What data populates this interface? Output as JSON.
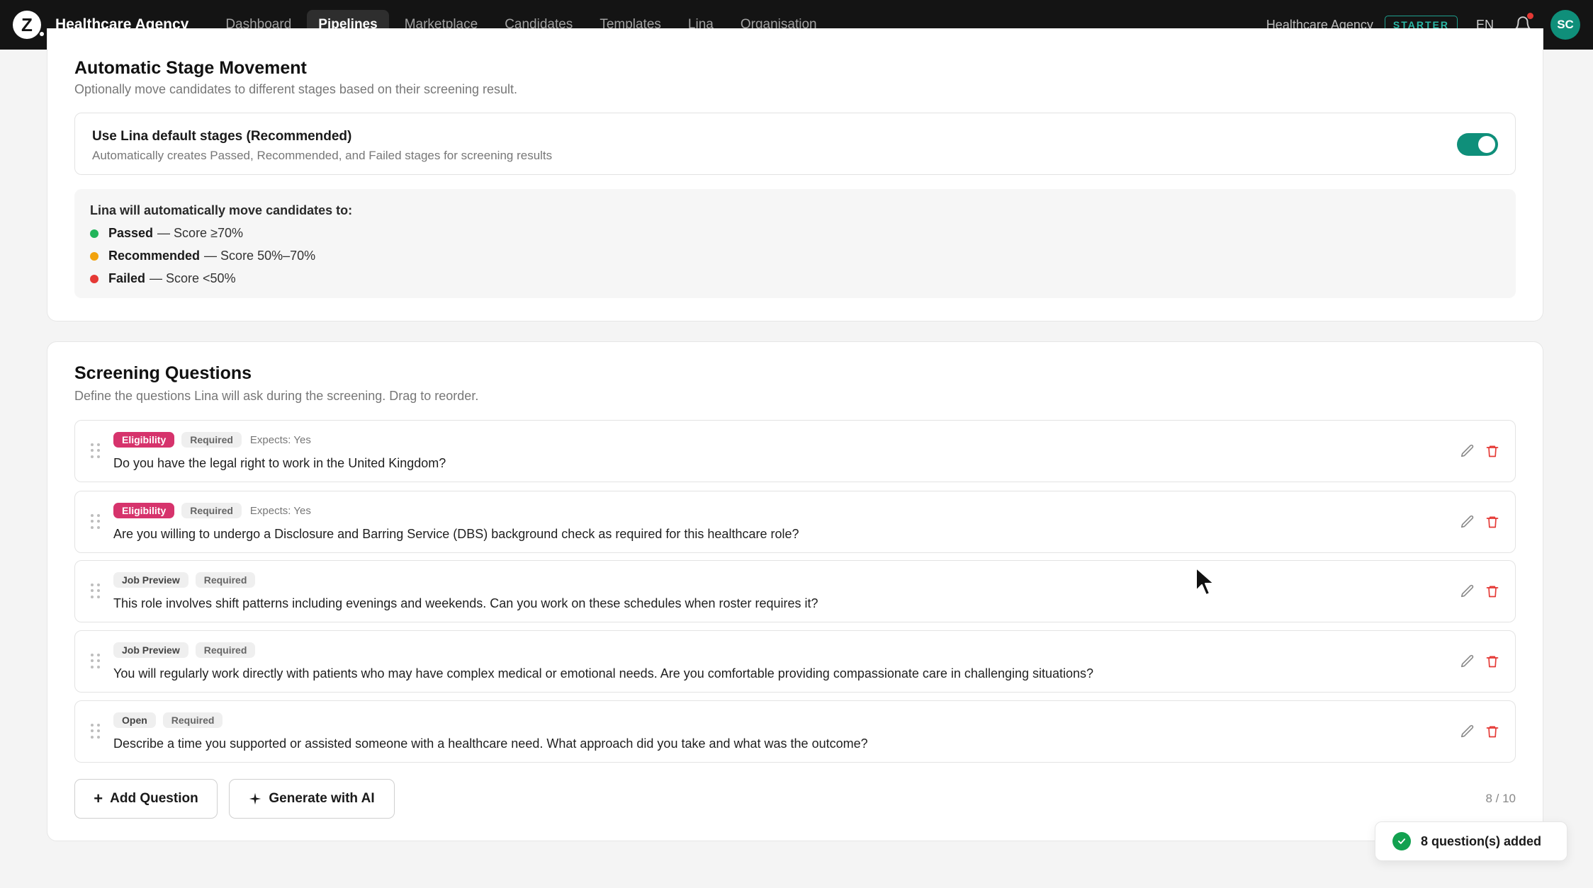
{
  "nav": {
    "logo_letter": "Z",
    "brand": "Healthcare Agency",
    "links": [
      {
        "label": "Dashboard",
        "active": false
      },
      {
        "label": "Pipelines",
        "active": true
      },
      {
        "label": "Marketplace",
        "active": false
      },
      {
        "label": "Candidates",
        "active": false
      },
      {
        "label": "Templates",
        "active": false
      },
      {
        "label": "Lina",
        "active": false
      },
      {
        "label": "Organisation",
        "active": false
      }
    ],
    "org_name": "Healthcare Agency",
    "plan": "STARTER",
    "language": "EN",
    "avatar_initials": "SC",
    "icons": {
      "notifications": "bell-icon"
    }
  },
  "stage_movement": {
    "title": "Automatic Stage Movement",
    "subtitle": "Optionally move candidates to different stages based on their screening result.",
    "toggle": {
      "label": "Use Lina default stages (Recommended)",
      "description": "Automatically creates Passed, Recommended, and Failed stages for screening results",
      "enabled": true
    },
    "info_heading": "Lina will automatically move candidates to:",
    "rules": [
      {
        "stage": "Passed",
        "rule": "— Score ≥70%",
        "color": "#22b45a"
      },
      {
        "stage": "Recommended",
        "rule": "— Score 50%–70%",
        "color": "#f2a20c"
      },
      {
        "stage": "Failed",
        "rule": "— Score <50%",
        "color": "#e53935"
      }
    ]
  },
  "screening": {
    "title": "Screening Questions",
    "subtitle": "Define the questions Lina will ask during the screening. Drag to reorder.",
    "questions": [
      {
        "category": "Eligibility",
        "required": "Required",
        "expects": "Expects: Yes",
        "text": "Do you have the legal right to work in the United Kingdom?"
      },
      {
        "category": "Eligibility",
        "required": "Required",
        "expects": "Expects: Yes",
        "text": "Are you willing to undergo a Disclosure and Barring Service (DBS) background check as required for this healthcare role?"
      },
      {
        "category": "Job Preview",
        "required": "Required",
        "expects": "",
        "text": "This role involves shift patterns including evenings and weekends. Can you work on these schedules when roster requires it?"
      },
      {
        "category": "Job Preview",
        "required": "Required",
        "expects": "",
        "text": "You will regularly work directly with patients who may have complex medical or emotional needs. Are you comfortable providing compassionate care in challenging situations?"
      },
      {
        "category": "Open",
        "required": "Required",
        "expects": "",
        "text": "Describe a time you supported or assisted someone with a healthcare need. What approach did you take and what was the outcome?"
      }
    ],
    "add_button": "Add Question",
    "ai_button": "Generate with AI",
    "counter": "8 / 10",
    "icons": {
      "edit": "pencil-icon",
      "delete": "trash-icon",
      "drag": "drag-handle-icon"
    }
  },
  "toast": {
    "message": "8 question(s) added",
    "icon": "check-circle-icon"
  },
  "colors": {
    "nav_bg": "#141414",
    "accent": "#0f8f7a",
    "eligibility": "#d6336c",
    "danger": "#e53935"
  }
}
